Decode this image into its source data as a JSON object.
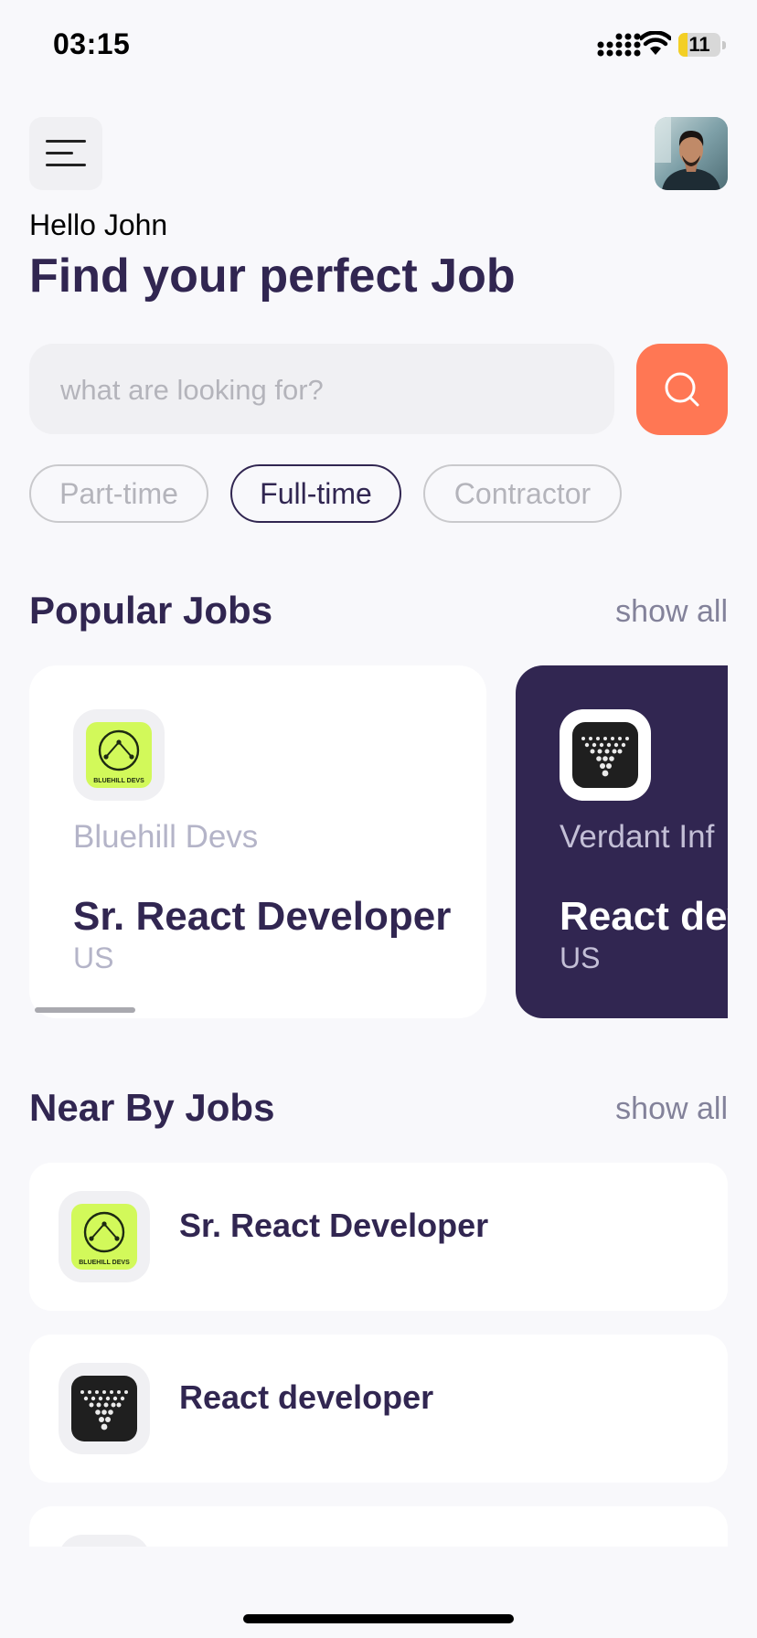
{
  "status_bar": {
    "time": "03:15",
    "battery": "11"
  },
  "header": {
    "menu_icon": "hamburger-menu-icon",
    "avatar": "user-profile-photo",
    "greeting": "Hello John",
    "headline": "Find your perfect Job"
  },
  "search": {
    "placeholder": "what are looking for?",
    "value": "",
    "button_icon": "search-icon"
  },
  "job_types": [
    {
      "label": "Part-time",
      "active": false
    },
    {
      "label": "Full-time",
      "active": true
    },
    {
      "label": "Contractor",
      "active": false
    }
  ],
  "popular": {
    "title": "Popular Jobs",
    "show_all": "show all",
    "cards": [
      {
        "company": "Bluehill Devs",
        "role": "Sr. React Developer",
        "country": "US",
        "logo_text": "BLUEHILL DEVS",
        "selected": false
      },
      {
        "company": "Verdant Inf",
        "role": "React dev",
        "country": "US",
        "selected": true
      }
    ]
  },
  "nearby": {
    "title": "Near By Jobs",
    "show_all": "show all",
    "items": [
      {
        "title": "Sr. React Developer",
        "logo_text": "BLUEHILL DEVS"
      },
      {
        "title": "React developer"
      }
    ]
  },
  "colors": {
    "primary": "#312651",
    "accent": "#ff7754",
    "gray": "#83829a",
    "lime": "#d2f95a"
  }
}
